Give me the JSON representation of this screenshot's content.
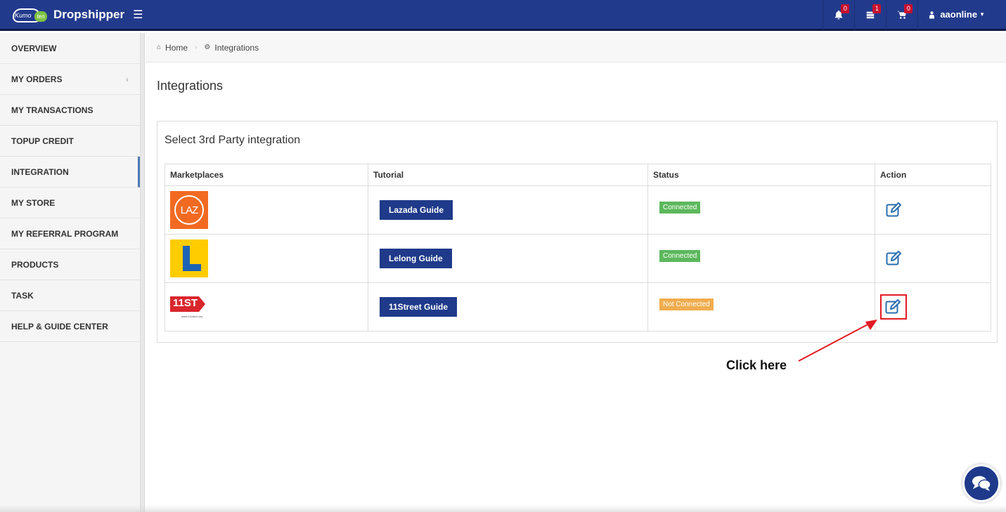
{
  "header": {
    "logo_kumo": "Kumo",
    "logo_ten": "ten",
    "brand": "Dropshipper",
    "notifications_count": "0",
    "messages_count": "1",
    "cart_count": "0",
    "username": "aaonline"
  },
  "sidebar": {
    "items": [
      {
        "label": "OVERVIEW"
      },
      {
        "label": "MY ORDERS"
      },
      {
        "label": "MY TRANSACTIONS"
      },
      {
        "label": "TOPUP CREDIT"
      },
      {
        "label": "INTEGRATION"
      },
      {
        "label": "MY STORE"
      },
      {
        "label": "MY REFERRAL PROGRAM"
      },
      {
        "label": "PRODUCTS"
      },
      {
        "label": "TASK"
      },
      {
        "label": "HELP & GUIDE CENTER"
      }
    ],
    "active": "INTEGRATION"
  },
  "breadcrumb": {
    "home": "Home",
    "current": "Integrations"
  },
  "page_title": "Integrations",
  "panel": {
    "title": "Select 3rd Party integration",
    "columns": [
      "Marketplaces",
      "Tutorial",
      "Status",
      "Action"
    ],
    "rows": [
      {
        "marketplace": "Lazada",
        "logo_text": "LAZ",
        "guide": "Lazada Guide",
        "status": "Connected"
      },
      {
        "marketplace": "Lelong",
        "logo_text": "",
        "guide": "Lelong Guide",
        "status": "Connected"
      },
      {
        "marketplace": "11Street",
        "logo_text": "11ST",
        "logo_url_text": "www.11street.my",
        "guide": "11Street Guide",
        "status": "Not Connected"
      }
    ]
  },
  "annotation": {
    "text": "Click here",
    "color": "#e31b23"
  },
  "colors": {
    "topbar": "#223a8c",
    "button": "#1f3a8a",
    "connected": "#5cb85c",
    "not_connected": "#f0ad4e"
  }
}
